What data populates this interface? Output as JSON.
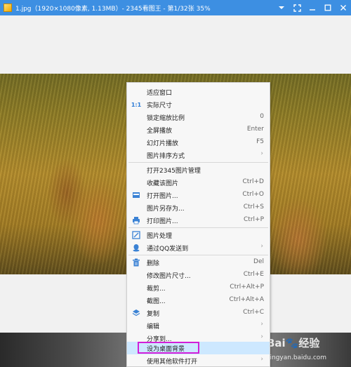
{
  "window": {
    "title": "1.jpg（1920×1080像素, 1.13MB）- 2345看图王 - 第1/32张 35%"
  },
  "menu": {
    "items": [
      {
        "label": "适应窗口",
        "shortcut": "",
        "submenu": false,
        "icon": ""
      },
      {
        "label": "实际尺寸",
        "shortcut": "",
        "submenu": false,
        "icon": "actual-size-icon",
        "icon_text": "1:1"
      },
      {
        "label": "锁定缩放比例",
        "shortcut": "0",
        "submenu": false,
        "icon": ""
      },
      {
        "label": "全屏播放",
        "shortcut": "Enter",
        "submenu": false,
        "icon": ""
      },
      {
        "label": "幻灯片播放",
        "shortcut": "F5",
        "submenu": false,
        "icon": ""
      },
      {
        "label": "图片排序方式",
        "shortcut": "",
        "submenu": true,
        "icon": ""
      },
      {
        "label": "打开2345图片管理",
        "shortcut": "",
        "submenu": false,
        "icon": ""
      },
      {
        "label": "收藏该图片",
        "shortcut": "Ctrl+D",
        "submenu": false,
        "icon": ""
      },
      {
        "label": "打开图片...",
        "shortcut": "Ctrl+O",
        "submenu": false,
        "icon": "open-folder-icon"
      },
      {
        "label": "图片另存为...",
        "shortcut": "Ctrl+S",
        "submenu": false,
        "icon": ""
      },
      {
        "label": "打印图片...",
        "shortcut": "Ctrl+P",
        "submenu": false,
        "icon": "printer-icon"
      },
      {
        "label": "图片处理",
        "shortcut": "",
        "submenu": false,
        "icon": "image-edit-icon"
      },
      {
        "label": "通过QQ发送到",
        "shortcut": "",
        "submenu": true,
        "icon": "qq-icon"
      },
      {
        "label": "删除",
        "shortcut": "Del",
        "submenu": false,
        "icon": "trash-icon"
      },
      {
        "label": "修改图片尺寸...",
        "shortcut": "Ctrl+E",
        "submenu": false,
        "icon": ""
      },
      {
        "label": "裁剪...",
        "shortcut": "Ctrl+Alt+P",
        "submenu": false,
        "icon": ""
      },
      {
        "label": "截图...",
        "shortcut": "Ctrl+Alt+A",
        "submenu": false,
        "icon": ""
      },
      {
        "label": "复制",
        "shortcut": "Ctrl+C",
        "submenu": false,
        "icon": "copy-icon"
      },
      {
        "label": "编辑",
        "shortcut": "",
        "submenu": true,
        "icon": ""
      },
      {
        "label": "分享到...",
        "shortcut": "",
        "submenu": true,
        "icon": ""
      },
      {
        "label": "设为桌面背景",
        "shortcut": "",
        "submenu": false,
        "icon": "",
        "highlighted": true
      },
      {
        "label": "使用其他软件打开",
        "shortcut": "",
        "submenu": true,
        "icon": ""
      }
    ]
  },
  "watermark": {
    "logo": "Bai🐾经验",
    "sub": "jingyan.baidu.com"
  },
  "colors": {
    "titlebar": "#3d8fe2",
    "highlight_box": "#d21fd8",
    "menu_hover": "#cde8ff"
  }
}
